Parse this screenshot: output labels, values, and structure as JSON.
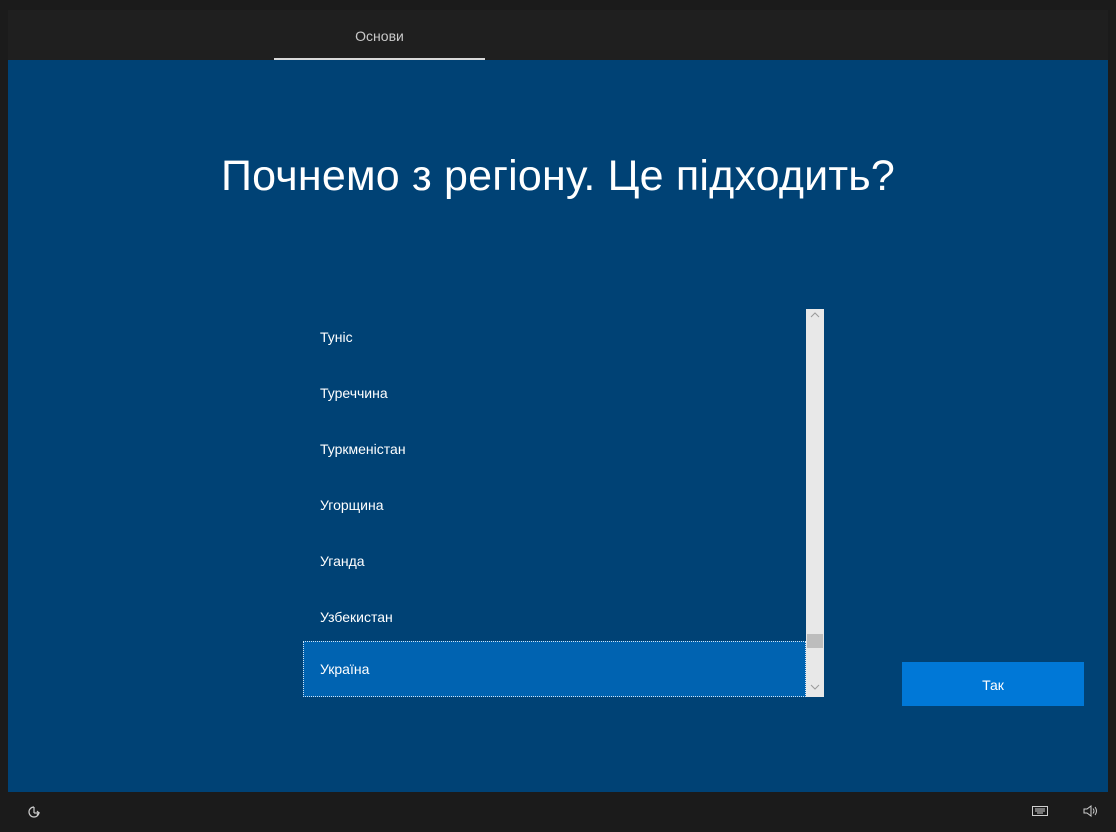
{
  "header": {
    "tab_label": "Основи"
  },
  "main": {
    "title": "Почнемо з регіону. Це підходить?",
    "regions": [
      {
        "label": "Туніс",
        "selected": false
      },
      {
        "label": "Туреччина",
        "selected": false
      },
      {
        "label": "Туркменістан",
        "selected": false
      },
      {
        "label": "Угорщина",
        "selected": false
      },
      {
        "label": "Уганда",
        "selected": false
      },
      {
        "label": "Узбекистан",
        "selected": false
      },
      {
        "label": "Україна",
        "selected": true
      }
    ],
    "yes_label": "Так"
  },
  "footer": {
    "accessibility_icon": "accessibility-icon",
    "keyboard_icon": "keyboard-icon",
    "volume_icon": "volume-icon"
  },
  "colors": {
    "background_blue": "#004275",
    "selection_blue": "#0063b1",
    "accent_button": "#0078d7",
    "bar_black": "#1f1f1f"
  }
}
